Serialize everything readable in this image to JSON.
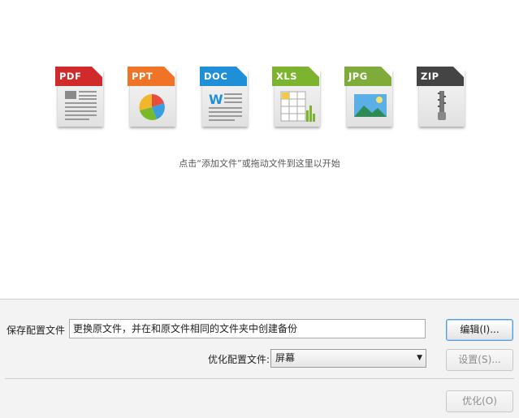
{
  "file_types": [
    {
      "label": "PDF",
      "color": "#d02a2a",
      "icon": "pdf-file-icon"
    },
    {
      "label": "PPT",
      "color": "#ef7427",
      "icon": "ppt-file-icon"
    },
    {
      "label": "DOC",
      "color": "#1f8fd8",
      "icon": "doc-file-icon"
    },
    {
      "label": "XLS",
      "color": "#7cb430",
      "icon": "xls-file-icon"
    },
    {
      "label": "JPG",
      "color": "#7fab3a",
      "icon": "jpg-file-icon"
    },
    {
      "label": "ZIP",
      "color": "#444444",
      "icon": "zip-file-icon"
    }
  ],
  "drop_area": {
    "hint": "点击“添加文件”或拖动文件到这里以开始"
  },
  "save_config": {
    "label": "保存配置文件",
    "value": "更换原文件，并在和原文件相同的文件夹中创建备份"
  },
  "optimize_config": {
    "label": "优化配置文件:",
    "selected": "屏幕"
  },
  "buttons": {
    "edit": "编辑(I)...",
    "settings": "设置(S)...",
    "optimize": "优化(O)"
  }
}
